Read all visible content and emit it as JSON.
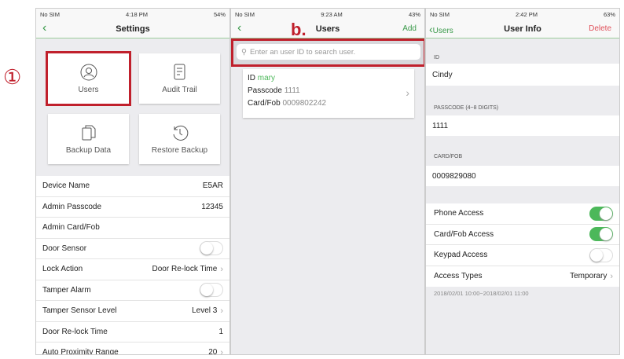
{
  "annotations": {
    "step1": "①",
    "step_b": "b."
  },
  "settings": {
    "status": {
      "carrier": "No SIM",
      "time": "4:18 PM",
      "battery": "54%"
    },
    "title": "Settings",
    "tiles": [
      {
        "label": "Users",
        "icon": "user-icon"
      },
      {
        "label": "Audit Trail",
        "icon": "document-icon"
      },
      {
        "label": "Backup Data",
        "icon": "copy-icon"
      },
      {
        "label": "Restore Backup",
        "icon": "history-icon"
      }
    ],
    "rows": [
      {
        "label": "Device Name",
        "value": "E5AR"
      },
      {
        "label": "Admin Passcode",
        "value": "12345"
      },
      {
        "label": "Admin Card/Fob",
        "value": ""
      },
      {
        "label": "Door Sensor",
        "toggle": false
      },
      {
        "label": "Lock Action",
        "value": "Door Re-lock Time",
        "chevron": true
      },
      {
        "label": "Tamper Alarm",
        "toggle": false
      },
      {
        "label": "Tamper Sensor Level",
        "value": "Level 3",
        "chevron": true
      },
      {
        "label": "Door Re-lock Time",
        "value": "1"
      },
      {
        "label": "Auto Proximity Range",
        "value": "20",
        "chevron": true
      }
    ]
  },
  "users": {
    "status": {
      "carrier": "No SIM",
      "time": "9:23 AM",
      "battery": "43%"
    },
    "title": "Users",
    "add": "Add",
    "search_placeholder": "Enter an user ID to search user.",
    "card": {
      "id_label": "ID",
      "id": "mary",
      "passcode_label": "Passcode",
      "passcode": "1111",
      "card_label": "Card/Fob",
      "card": "0009802242"
    }
  },
  "userinfo": {
    "status": {
      "carrier": "No SIM",
      "time": "2:42 PM",
      "battery": "63%"
    },
    "back": "Users",
    "title": "User Info",
    "delete": "Delete",
    "id_label": "ID",
    "id": "Cindy",
    "passcode_label": "PASSCODE (4~8 DIGITS)",
    "passcode": "1111",
    "card_label": "CARD/FOB",
    "card": "0009829080",
    "phone_access": "Phone Access",
    "card_access": "Card/Fob Access",
    "keypad_access": "Keypad Access",
    "access_types": "Access Types",
    "access_type_value": "Temporary",
    "date_range": "2018/02/01 10:00~2018/02/01 11:00"
  },
  "colors": {
    "accent": "#3a9a4a",
    "highlight": "#c0202c",
    "delete": "#e0505a"
  }
}
